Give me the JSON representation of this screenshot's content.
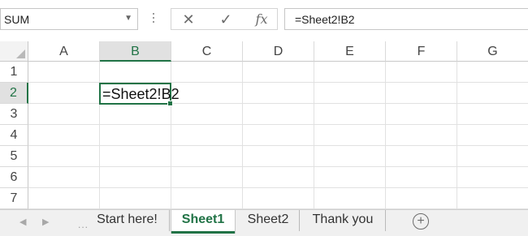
{
  "formula_bar": {
    "name_box": "SUM",
    "cancel_symbol": "✕",
    "enter_symbol": "✓",
    "function_symbol": "fx",
    "formula": "=Sheet2!B2"
  },
  "columns": [
    "A",
    "B",
    "C",
    "D",
    "E",
    "F",
    "G"
  ],
  "rows": [
    "1",
    "2",
    "3",
    "4",
    "5",
    "6",
    "7"
  ],
  "selected_column": "B",
  "selected_row": "2",
  "active_cell": {
    "ref": "B2",
    "value": "=Sheet2!B2"
  },
  "sheet_tabs": [
    "Start here!",
    "Sheet1",
    "Sheet2",
    "Thank you"
  ],
  "active_sheet": "Sheet1",
  "nav": {
    "prev": "◀",
    "next": "▶",
    "more": "...",
    "add": "+"
  },
  "colors": {
    "accent": "#217346",
    "grid": "#e1e1e1",
    "header_selected": "#e1e1e1"
  }
}
